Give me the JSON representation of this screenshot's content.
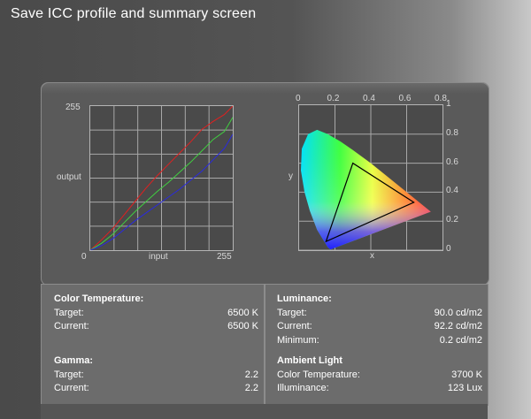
{
  "title": "Save ICC profile and summary screen",
  "curve_plot": {
    "y_max_label": "255",
    "y_label": "output",
    "x_min_label": "0",
    "x_label": "input",
    "x_max_label": "255"
  },
  "chart_data": [
    {
      "type": "line",
      "title": "",
      "xlabel": "input",
      "ylabel": "output",
      "xlim": [
        0,
        255
      ],
      "ylim": [
        0,
        255
      ],
      "grid": true,
      "series": [
        {
          "color": "#e02020",
          "x": [
            0,
            20,
            40,
            60,
            80,
            100,
            120,
            140,
            160,
            180,
            200,
            220,
            240,
            255
          ],
          "y": [
            0,
            18,
            38,
            62,
            86,
            110,
            132,
            152,
            172,
            192,
            214,
            228,
            240,
            255
          ]
        },
        {
          "color": "#40d040",
          "x": [
            0,
            20,
            40,
            60,
            80,
            100,
            120,
            140,
            160,
            180,
            200,
            220,
            240,
            255
          ],
          "y": [
            0,
            12,
            28,
            48,
            68,
            86,
            104,
            120,
            138,
            156,
            176,
            196,
            210,
            235
          ]
        },
        {
          "color": "#2a2ae0",
          "x": [
            0,
            20,
            40,
            60,
            80,
            100,
            120,
            140,
            160,
            180,
            200,
            220,
            240,
            255
          ],
          "y": [
            0,
            8,
            20,
            36,
            52,
            66,
            80,
            94,
            108,
            124,
            140,
            160,
            180,
            205
          ]
        }
      ]
    },
    {
      "type": "scatter",
      "title": "",
      "xlabel": "x",
      "ylabel": "y",
      "xlim": [
        0,
        0.8
      ],
      "ylim": [
        0,
        1
      ],
      "x_ticks": [
        "0",
        "0.2",
        "0.4",
        "0.6",
        "0.8"
      ],
      "y_ticks": [
        "1",
        "0.8",
        "0.6",
        "0.4",
        "0.2",
        "0"
      ],
      "grid": true,
      "gamut_triangle": {
        "x": [
          0.64,
          0.3,
          0.15
        ],
        "y": [
          0.33,
          0.6,
          0.06
        ]
      }
    }
  ],
  "left_info": {
    "color_temperature_heading": "Color Temperature:",
    "target_label": "Target:",
    "target_value": "6500 K",
    "current_label": "Current:",
    "current_value": "6500 K",
    "gamma_heading": "Gamma:",
    "gamma_target_label": "Target:",
    "gamma_target_value": "2.2",
    "gamma_current_label": "Current:",
    "gamma_current_value": "2.2"
  },
  "right_info": {
    "luminance_heading": "Luminance:",
    "target_label": "Target:",
    "target_value": "90.0 cd/m2",
    "current_label": "Current:",
    "current_value": "92.2 cd/m2",
    "minimum_label": "Minimum:",
    "minimum_value": "0.2 cd/m2",
    "ambient_heading": "Ambient Light",
    "ct_label": "Color Temperature:",
    "ct_value": "3700 K",
    "illum_label": "Illuminance:",
    "illum_value": "123 Lux"
  }
}
